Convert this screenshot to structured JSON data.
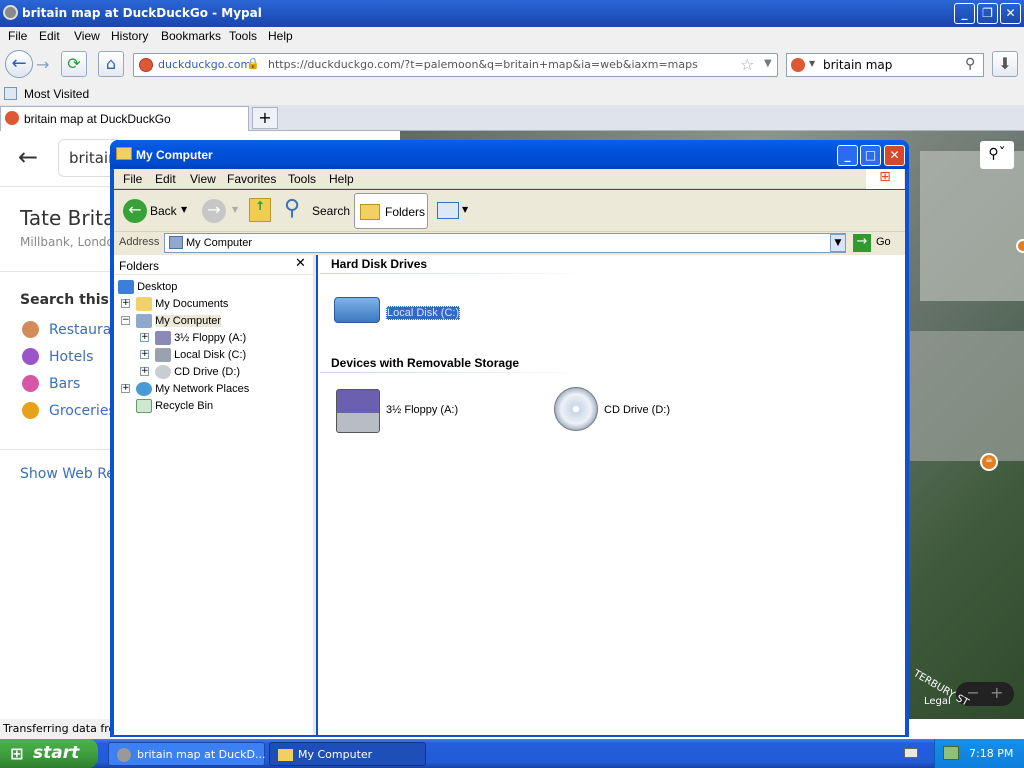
{
  "browser": {
    "title": "britain map at DuckDuckGo - Mypal",
    "menu": [
      "File",
      "Edit",
      "View",
      "History",
      "Bookmarks",
      "Tools",
      "Help"
    ],
    "url_site": "duckduckgo.com",
    "url": "https://duckduckgo.com/?t=palemoon&q=britain+map&ia=web&iaxm=maps",
    "search_value": "britain map",
    "bookmark": "Most Visited",
    "tab": "britain map at DuckDuckGo",
    "status": "Transferring data from"
  },
  "page": {
    "search_value": "britain",
    "place_title": "Tate Brita",
    "place_addr": "Millbank, Londo",
    "search_area": "Search this a",
    "categories": [
      "Restaurants",
      "Hotels",
      "Bars",
      "Groceries"
    ],
    "cat_colors": [
      "#d48b5a",
      "#9b55c9",
      "#d657a6",
      "#e8a21a"
    ],
    "show_web": "Show Web Res",
    "map_legal": "Legal",
    "map_street": "TERBURY ST"
  },
  "explorer": {
    "title": "My Computer",
    "menu": [
      "File",
      "Edit",
      "View",
      "Favorites",
      "Tools",
      "Help"
    ],
    "toolbar": {
      "back": "Back",
      "search": "Search",
      "folders": "Folders"
    },
    "address_label": "Address",
    "address_value": "My Computer",
    "go": "Go",
    "folders_title": "Folders",
    "tree": [
      "Desktop",
      "My Documents",
      "My Computer",
      "3½ Floppy (A:)",
      "Local Disk (C:)",
      "CD Drive (D:)",
      "My Network Places",
      "Recycle Bin"
    ],
    "groups": [
      {
        "name": "Hard Disk Drives",
        "items": [
          "Local Disk (C:)"
        ]
      },
      {
        "name": "Devices with Removable Storage",
        "items": [
          "3½ Floppy (A:)",
          "CD Drive (D:)"
        ]
      }
    ]
  },
  "taskbar": {
    "start": "start",
    "buttons": [
      "britain map at DuckD...",
      "My Computer"
    ],
    "time": "7:18 PM"
  }
}
